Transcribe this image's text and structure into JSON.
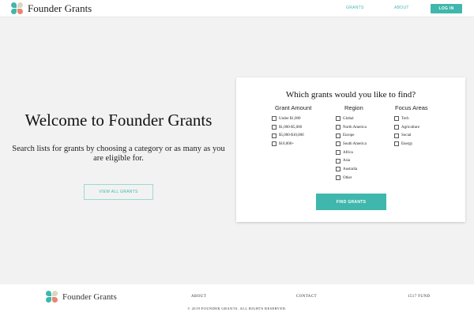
{
  "header": {
    "brand": "Founder Grants",
    "nav": {
      "grants": "GRANTS",
      "about": "ABOUT",
      "login": "LOG IN"
    }
  },
  "hero": {
    "title": "Welcome to Founder Grants",
    "subtitle": "Search lists for grants by choosing a category or as many as you are eligible for.",
    "view_all_label": "VIEW ALL GRANTS"
  },
  "search": {
    "title": "Which grants would you like to find?",
    "grant_amount": {
      "heading": "Grant Amount",
      "options": [
        "Under $1,000",
        "$1,000-$5,000",
        "$5,000-$10,000",
        "$10,000+"
      ]
    },
    "region": {
      "heading": "Region",
      "options": [
        "Global",
        "North America",
        "Europe",
        "South America",
        "Africa",
        "Asia",
        "Australia",
        "Other"
      ]
    },
    "focus_areas": {
      "heading": "Focus Areas",
      "options": [
        "Tech",
        "Agriculture",
        "Social",
        "Energy"
      ]
    },
    "find_label": "FIND GRANTS"
  },
  "footer": {
    "brand": "Founder Grants",
    "links": {
      "about": "ABOUT",
      "contact": "CONTACT",
      "fund": "1517 FUND"
    },
    "copyright": "© 2019 FOUNDER GRANTS. ALL RIGHTS RESERVED."
  },
  "colors": {
    "accent": "#3fb7ac",
    "logo_teal": "#3fb7ac",
    "logo_beige": "#d7d7c2",
    "logo_coral": "#e9856f",
    "page_background": "#f2f2f2"
  },
  "icons": {
    "logo": "four-petal-logo-icon",
    "checkbox": "checkbox-icon"
  }
}
